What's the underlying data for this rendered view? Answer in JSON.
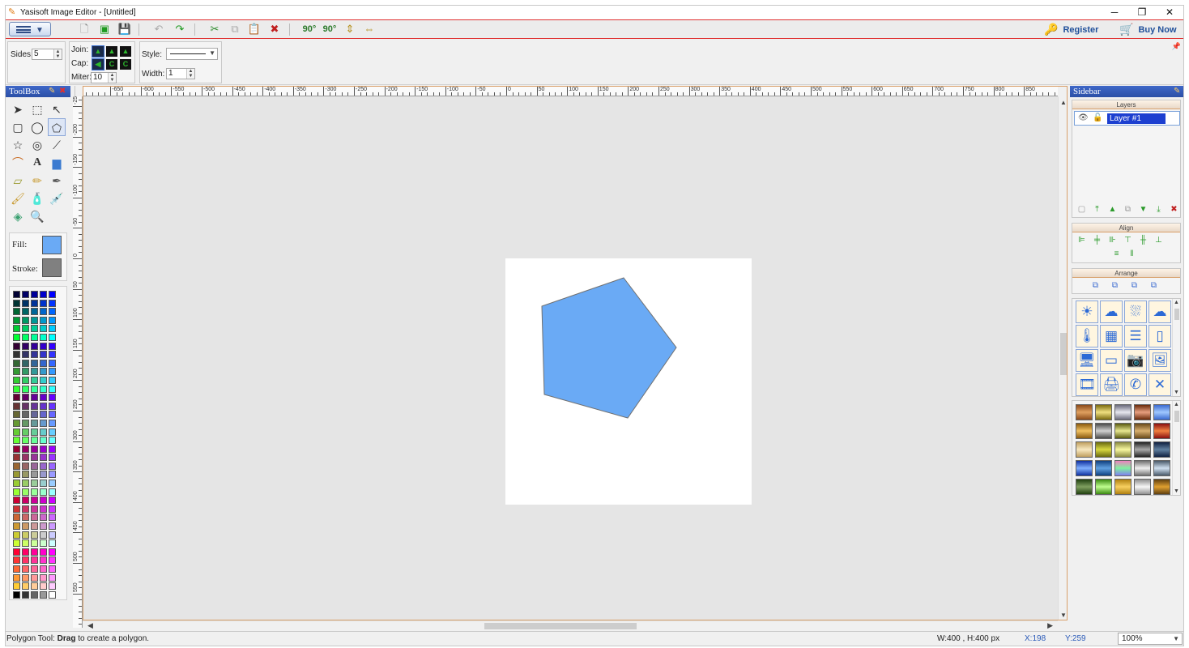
{
  "window": {
    "title": "Yasisoft Image Editor - [Untitled]",
    "controls": [
      "─",
      "❐",
      "✕"
    ]
  },
  "toolbar": {
    "menu_icon": "list-menu-icon",
    "register_label": "Register",
    "buy_label": "Buy Now",
    "rotate_left_label": "90°",
    "rotate_right_label": "90°"
  },
  "properties": {
    "sides_label": "Sides:",
    "sides_value": "5",
    "join_label": "Join:",
    "cap_label": "Cap:",
    "miter_label": "Miter:",
    "miter_value": "10",
    "style_label": "Style:",
    "width_label": "Width:",
    "width_value": "1"
  },
  "toolbox": {
    "title": "ToolBox",
    "selected_tool": "polygon-tool",
    "fill_label": "Fill:",
    "stroke_label": "Stroke:",
    "fill_color": "#6aaaf5",
    "stroke_color": "#808080"
  },
  "ruler": {
    "top_labels": [
      "-650",
      "-600",
      "-550",
      "-500",
      "-450",
      "-400",
      "-350",
      "-300",
      "-250",
      "-200",
      "-150",
      "-100",
      "-50",
      "0",
      "50",
      "100",
      "150",
      "200",
      "250",
      "300",
      "350",
      "400",
      "450",
      "500",
      "550",
      "600",
      "650",
      "700",
      "750",
      "800",
      "850"
    ],
    "left_labels": [
      "-250",
      "-200",
      "-150",
      "-100",
      "-50",
      "0",
      "50",
      "100",
      "150",
      "200",
      "250",
      "300",
      "350",
      "400",
      "450",
      "500",
      "550"
    ]
  },
  "canvas": {
    "shape_fill": "#6aaaf5",
    "shape_stroke": "#707070",
    "shape_type": "pentagon"
  },
  "sidebar": {
    "title": "Sidebar",
    "layers_title": "Layers",
    "layer_name": "Layer #1",
    "align_title": "Align",
    "arrange_title": "Arrange",
    "shape_icons": [
      "☀",
      "☁",
      "⛆",
      "☁",
      "🌡",
      "▦",
      "☰",
      "▯",
      "🖥",
      "▭",
      "📷",
      "🖼",
      "🎞",
      "🖨",
      "✆",
      "✕"
    ]
  },
  "status": {
    "hint_prefix": "Polygon Tool: ",
    "hint_bold": "Drag",
    "hint_suffix": " to create a polygon.",
    "size": "W:400 , H:400 px",
    "x": "X:198",
    "y": "Y:259",
    "zoom": "100%"
  }
}
